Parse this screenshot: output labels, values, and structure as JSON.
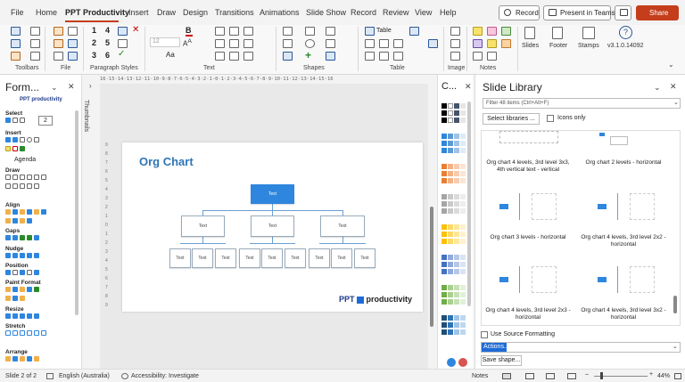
{
  "menu": {
    "items": [
      "File",
      "Home",
      "PPT Productivity",
      "Insert",
      "Draw",
      "Design",
      "Transitions",
      "Animations",
      "Slide Show",
      "Record",
      "Review",
      "View",
      "Help"
    ],
    "active": "PPT Productivity",
    "record_label": "Record",
    "present_label": "Present in Teams",
    "share_label": "Share",
    "accent": "#c43e1c"
  },
  "ribbon": {
    "groups": [
      "Toolbars",
      "File",
      "Paragraph Styles",
      "Text",
      "Shapes",
      "Table",
      "Image",
      "Notes"
    ],
    "numbers": [
      "1",
      "4",
      "2",
      "5",
      "3",
      "6"
    ],
    "font_size": "12",
    "table_label": "Table",
    "slides_label": "Slides",
    "footer_label": "Footer",
    "stamps_label": "Stamps",
    "version_label": "v3.1.0.14092"
  },
  "ruler_text": "16·15·14·13·12·11·10·9·8·7·6·5·4·3·2·1·0·1·2·3·4·5·6·7·8·9·10·11·12·13·14·15·16",
  "left_pane": {
    "title": "Form...",
    "logo": "PPT productivity",
    "select_label": "Select",
    "select_value": "2",
    "sections": [
      "Insert",
      "Draw",
      "Align",
      "Gaps",
      "Nudge",
      "Position",
      "Paint Format",
      "Resize",
      "Stretch",
      "Arrange"
    ],
    "agenda_label": "Agenda"
  },
  "thumbnails_label": "Thumbnails",
  "slide": {
    "title": "Org Chart",
    "box_text": "Text",
    "logo_prefix": "PPT",
    "logo_suffix": "productivity",
    "title_color": "#2e75b6",
    "top_box_color": "#2e86de"
  },
  "color_pane": {
    "title": "C..."
  },
  "slide_library": {
    "title": "Slide Library",
    "filter_text": "Filter 48 items (Ctrl+Alt+F)",
    "select_libraries": "Select libraries ...",
    "icons_only": "Icons only",
    "items": [
      "Org chart 4 levels, 3rd level 3x3, 4th vertical text - vertical",
      "Org chart 2 levels - horizontal",
      "Org chart 3 levels - horizontal",
      "Org chart 4 levels, 3rd level 2x2 - horizontal",
      "Org chart 4 levels, 3rd level 2x3 - horizontal",
      "Org chart 4 levels, 3rd level 3x2 - horizontal"
    ],
    "use_source_formatting": "Use Source Formatting",
    "actions_label": "Actions...",
    "save_shape": "Save shape..."
  },
  "status_bar": {
    "slide_info": "Slide 2 of 2",
    "language": "English (Australia)",
    "accessibility": "Accessibility: Investigate",
    "notes_label": "Notes",
    "zoom": "44%"
  }
}
